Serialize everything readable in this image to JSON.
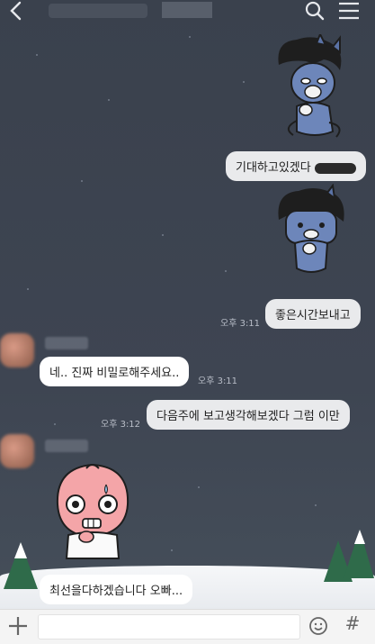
{
  "header": {
    "back_icon": "chevron-left-icon",
    "search_icon": "search-icon",
    "menu_icon": "hamburger-menu-icon"
  },
  "messages": {
    "out1": "기대하고있겠다",
    "out2": "좋은시간보내고",
    "out2_time": "오후 3:11",
    "in1": "네.. 진짜 비밀로해주세요..",
    "in1_time": "오후 3:11",
    "out3": "다음주에 보고생각해보겠다 그럼 이만",
    "out3_time": "오후 3:12",
    "in2": "최선을다하겠습니다 오빠..."
  },
  "footer": {
    "hash_label": "#",
    "plus_icon": "plus-icon",
    "emoji_icon": "emoji-icon"
  },
  "colors": {
    "background": "#3c4350",
    "bubble_out": "#e9eaec",
    "bubble_in": "#ffffff"
  }
}
